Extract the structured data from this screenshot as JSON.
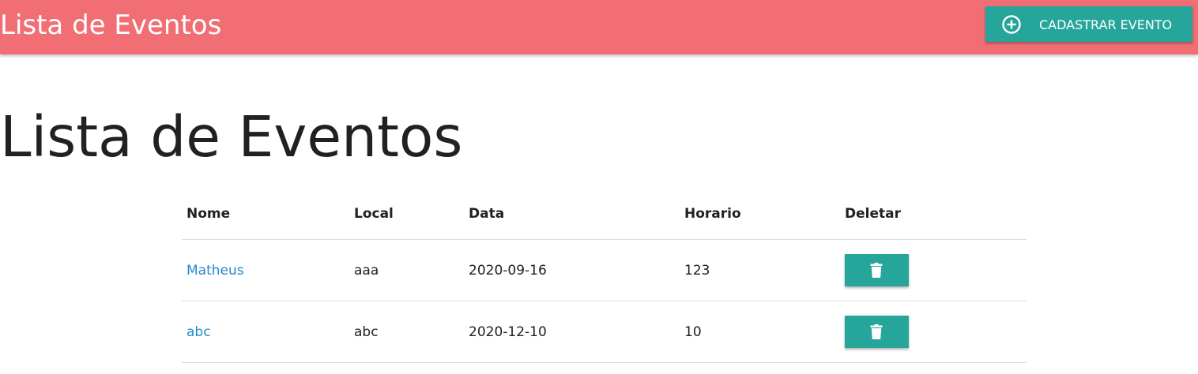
{
  "navbar": {
    "brand": "Lista de Eventos",
    "add_button_label": "CADASTRAR EVENTO",
    "add_button_icon": "plus-circle-icon"
  },
  "main": {
    "title": "Lista de Eventos"
  },
  "table": {
    "headers": [
      "Nome",
      "Local",
      "Data",
      "Horario",
      "Deletar"
    ],
    "rows": [
      {
        "nome": "Matheus",
        "local": "aaa",
        "data": "2020-09-16",
        "horario": "123",
        "delete_icon": "trash-icon"
      },
      {
        "nome": "abc",
        "local": "abc",
        "data": "2020-12-10",
        "horario": "10",
        "delete_icon": "trash-icon"
      }
    ]
  },
  "colors": {
    "navbar": "#f06e74",
    "accent": "#26a69a",
    "link": "#2389c9"
  }
}
